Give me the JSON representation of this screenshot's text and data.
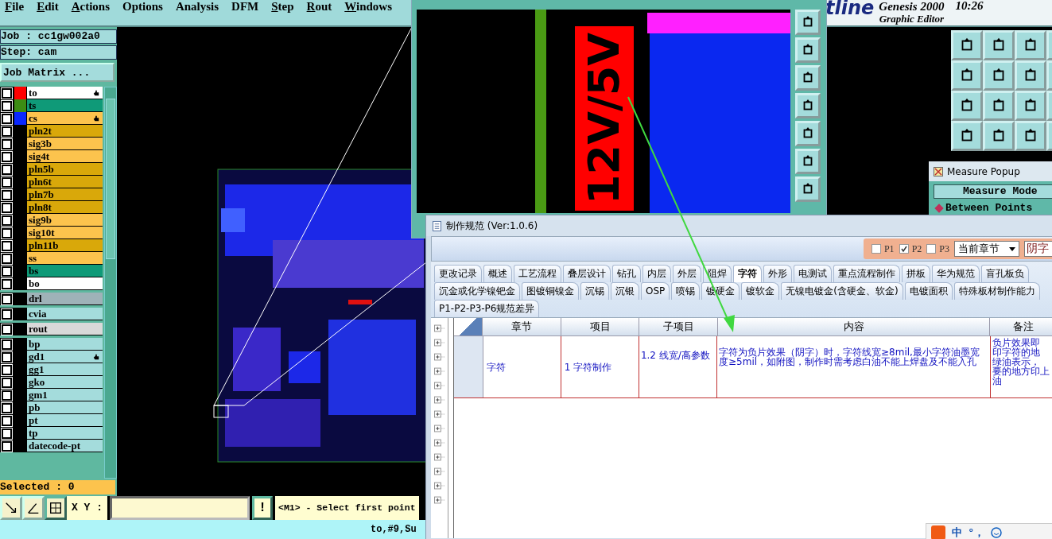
{
  "menu": [
    {
      "label": "File",
      "mnemonic": true
    },
    {
      "label": "Edit",
      "mnemonic": true
    },
    {
      "label": "Actions",
      "mnemonic": true
    },
    {
      "label": "Options",
      "mnemonic": false
    },
    {
      "label": "Analysis",
      "mnemonic": false
    },
    {
      "label": "DFM",
      "mnemonic": false
    },
    {
      "label": "Step",
      "mnemonic": true
    },
    {
      "label": "Rout",
      "mnemonic": true
    },
    {
      "label": "Windows",
      "mnemonic": true
    }
  ],
  "logo": {
    "brand": "tline",
    "product": "Genesis 2000",
    "subtitle": "Graphic Editor"
  },
  "clock": "10:26",
  "job": {
    "job": "Job : cc1gw002a0",
    "step": "Step: cam",
    "matrix_button": "Job Matrix ..."
  },
  "layer_groups": [
    {
      "layers": [
        {
          "name": "to",
          "kind": "silk",
          "color": "#ff0000",
          "checked": false,
          "affected": true
        },
        {
          "name": "ts",
          "kind": "mask",
          "color": "#3c8c14",
          "checked": false,
          "affected": false
        },
        {
          "name": "cs",
          "kind": "signal",
          "color": "#0a28ff",
          "checked": false,
          "affected": true
        },
        {
          "name": "pln2t",
          "kind": "plane",
          "checked": false,
          "affected": false
        },
        {
          "name": "sig3b",
          "kind": "signal",
          "checked": false,
          "affected": false
        },
        {
          "name": "sig4t",
          "kind": "signal",
          "checked": false,
          "affected": false
        },
        {
          "name": "pln5b",
          "kind": "plane",
          "checked": false,
          "affected": false
        },
        {
          "name": "pln6t",
          "kind": "plane",
          "checked": false,
          "affected": false
        },
        {
          "name": "pln7b",
          "kind": "plane",
          "checked": false,
          "affected": false
        },
        {
          "name": "pln8t",
          "kind": "plane",
          "checked": false,
          "affected": false
        },
        {
          "name": "sig9b",
          "kind": "signal",
          "checked": false,
          "affected": false
        },
        {
          "name": "sig10t",
          "kind": "signal",
          "checked": false,
          "affected": false
        },
        {
          "name": "pln11b",
          "kind": "plane",
          "checked": false,
          "affected": false
        },
        {
          "name": "ss",
          "kind": "signal",
          "checked": false,
          "affected": false
        },
        {
          "name": "bs",
          "kind": "mask",
          "checked": false,
          "affected": false
        },
        {
          "name": "bo",
          "kind": "silk",
          "checked": false,
          "affected": false
        }
      ]
    },
    {
      "layers": [
        {
          "name": "drl",
          "kind": "drill",
          "checked": false,
          "affected": false
        }
      ]
    },
    {
      "layers": [
        {
          "name": "cvia",
          "kind": "document",
          "checked": false,
          "affected": false
        }
      ]
    },
    {
      "layers": [
        {
          "name": "rout",
          "kind": "rout",
          "checked": false,
          "affected": false
        }
      ]
    },
    {
      "layers": [
        {
          "name": "bp",
          "kind": "document",
          "checked": false,
          "affected": false
        },
        {
          "name": "gd1",
          "kind": "document",
          "checked": false,
          "affected": true
        },
        {
          "name": "gg1",
          "kind": "document",
          "checked": false,
          "affected": false
        },
        {
          "name": "gko",
          "kind": "document",
          "checked": false,
          "affected": false
        },
        {
          "name": "gm1",
          "kind": "document",
          "checked": false,
          "affected": false
        },
        {
          "name": "pb",
          "kind": "document",
          "checked": false,
          "affected": false
        },
        {
          "name": "pt",
          "kind": "document",
          "checked": false,
          "affected": false
        },
        {
          "name": "tp",
          "kind": "document",
          "checked": false,
          "affected": false
        },
        {
          "name": "datecode-pt",
          "kind": "document",
          "checked": false,
          "affected": false
        }
      ]
    }
  ],
  "selected_count": "Selected : 0",
  "coord_label": "X Y :",
  "alert_button": "!",
  "prompt": "<M1> - Select first point",
  "status": "to,#9,Su",
  "zoom_window": {
    "silkscreen_text": "12V/5V"
  },
  "measure_popup": {
    "title": "Measure Popup",
    "mode_header": "Measure Mode",
    "modes": [
      {
        "label": "Between Points",
        "selected": true
      }
    ]
  },
  "spec_dialog": {
    "title": "制作规范 (Ver:1.0.6)",
    "filters": [
      {
        "label": "P1",
        "checked": false
      },
      {
        "label": "P2",
        "checked": true
      },
      {
        "label": "P3",
        "checked": false
      }
    ],
    "scope": "当前章节",
    "search_value": "阴字",
    "tab_rows": [
      [
        {
          "label": "更改记录",
          "selected": false
        },
        {
          "label": "概述",
          "selected": false
        },
        {
          "label": "工艺流程",
          "selected": false
        },
        {
          "label": "叠层设计",
          "selected": false
        },
        {
          "label": "钻孔",
          "selected": false
        },
        {
          "label": "内层",
          "selected": false
        },
        {
          "label": "外层",
          "selected": false
        },
        {
          "label": "阻焊",
          "selected": false
        },
        {
          "label": "字符",
          "selected": true
        },
        {
          "label": "外形",
          "selected": false
        },
        {
          "label": "电测试",
          "selected": false
        },
        {
          "label": "重点流程制作",
          "selected": false
        },
        {
          "label": "拼板",
          "selected": false
        },
        {
          "label": "华为规范",
          "selected": false
        },
        {
          "label": "盲孔板负",
          "selected": false
        }
      ],
      [
        {
          "label": "沉金或化学镍钯金",
          "selected": false
        },
        {
          "label": "图镀铜镍金",
          "selected": false
        },
        {
          "label": "沉锡",
          "selected": false
        },
        {
          "label": "沉银",
          "selected": false
        },
        {
          "label": "OSP",
          "selected": false
        },
        {
          "label": "喷锡",
          "selected": false
        },
        {
          "label": "镀硬金",
          "selected": false
        },
        {
          "label": "镀软金",
          "selected": false
        },
        {
          "label": "无镍电镀金(含硬金、软金)",
          "selected": false
        },
        {
          "label": "电镀面积",
          "selected": false
        },
        {
          "label": "特殊板材制作能力",
          "selected": false
        }
      ],
      [
        {
          "label": "P1-P2-P3-P6规范差异",
          "selected": false
        }
      ]
    ],
    "columns": [
      "章节",
      "项目",
      "子项目",
      "内容",
      "备注"
    ],
    "rows": [
      {
        "chapter": "字符",
        "item": "1 字符制作",
        "sub_item": "1.2 线宽/高参数",
        "content": "字符为负片效果（阴字）时，字符线宽≥8mil,最小字符油墨宽度≥5mil，如附图，制作时需考虑白油不能上焊盘及不能入孔",
        "remark_lines": [
          "负片效果即",
          "印字符的地",
          "绿油表示，",
          "要的地方印上",
          "油"
        ]
      }
    ]
  },
  "ime": {
    "mode": "中",
    "punct": "°，"
  }
}
